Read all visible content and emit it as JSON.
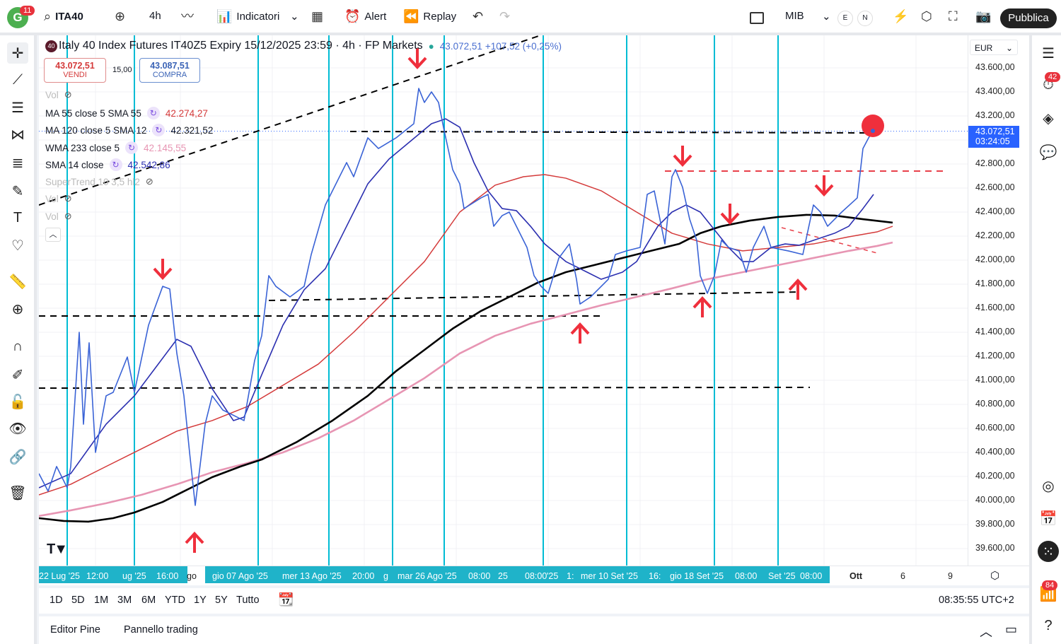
{
  "topbar": {
    "avatar_letter": "G",
    "avatar_badge": "11",
    "symbol": "ITA40",
    "interval": "4h",
    "indicators": "Indicatori",
    "alert": "Alert",
    "replay": "Replay",
    "layout_name": "MIB",
    "session_e": "E",
    "session_n": "N",
    "publish": "Pubblica"
  },
  "legend": {
    "badge": "40",
    "title": "Italy 40 Index Futures IT40Z5 Expiry 15/12/2025 23:59 · 4h · FP Markets",
    "last": "43.072,51",
    "change": "+107,52 (+0,25%)",
    "sell_price": "43.072,51",
    "sell_label": "VENDI",
    "spread": "15,00",
    "buy_price": "43.087,51",
    "buy_label": "COMPRA",
    "indicators": [
      {
        "name": "Vol",
        "value": ""
      },
      {
        "name": "MA 55 close 5 SMA 55",
        "value": "42.274,27"
      },
      {
        "name": "MA 120 close 5 SMA 12",
        "value": "42.321,52"
      },
      {
        "name": "WMA 233 close 5",
        "value": "42.145,55"
      },
      {
        "name": "SMA 14 close",
        "value": "42.542,86"
      },
      {
        "name": "SuperTrend 10 3,5 hl2",
        "value": ""
      },
      {
        "name": "Vol",
        "value": ""
      },
      {
        "name": "Vol",
        "value": ""
      }
    ]
  },
  "price_scale": {
    "currency": "EUR",
    "labels": [
      "43.600,00",
      "43.400,00",
      "43.200,00",
      "42.800,00",
      "42.600,00",
      "42.400,00",
      "42.200,00",
      "42.000,00",
      "41.800,00",
      "41.600,00",
      "41.400,00",
      "41.200,00",
      "41.000,00",
      "40.800,00",
      "40.600,00",
      "40.400,00",
      "40.200,00",
      "40.000,00",
      "39.800,00",
      "39.600,00"
    ],
    "current_price": "43.072,51",
    "countdown": "03:24:05"
  },
  "time_axis": {
    "labels": [
      "22 Lug '25",
      "12:00",
      "ug '25",
      "16:00",
      "go",
      "gio 07 Ago '25",
      "mer 13 Ago '25",
      "20:00",
      "g",
      "mar 26 Ago '25",
      "08:00",
      "25",
      "08:00",
      "'25",
      "1:",
      "mer 10 Set '25",
      "16:",
      "gio 18 Set '25",
      "08:00",
      "Set '25",
      "08:00",
      "Ott",
      "6",
      "9"
    ]
  },
  "ranges": [
    "1D",
    "5D",
    "1M",
    "3M",
    "6M",
    "YTD",
    "1Y",
    "5Y",
    "Tutto"
  ],
  "clock": "08:35:55 UTC+2",
  "bottom_tabs": [
    "Editor Pine",
    "Pannello trading"
  ],
  "sidebar": {
    "alerts_badge": "42",
    "notifications_badge": "84"
  },
  "colors": {
    "close": "#3a63d6",
    "sma14": "#2b2fb0",
    "ma55": "#d43a3a",
    "ma120": "#000000",
    "wma233": "#e795b3",
    "cyan": "#00bcd4",
    "arrow": "#ef2f3c"
  },
  "chart_data": {
    "type": "line",
    "ylim": [
      39500,
      43700
    ],
    "x_unit": "bar index (4h)",
    "series": [
      {
        "name": "close",
        "values": [
          [
            0,
            40224
          ],
          [
            1.3,
            40077
          ],
          [
            2.5,
            40283
          ],
          [
            4,
            40106
          ],
          [
            4.5,
            40283
          ],
          [
            5.7,
            41400
          ],
          [
            6.3,
            40635
          ],
          [
            7.1,
            41312
          ],
          [
            8,
            40400
          ],
          [
            9.5,
            40871
          ],
          [
            10.5,
            40900
          ],
          [
            12.5,
            41194
          ],
          [
            13.5,
            40900
          ],
          [
            15.5,
            41459
          ],
          [
            17.5,
            41782
          ],
          [
            18.5,
            41760
          ],
          [
            19.5,
            41224
          ],
          [
            20.5,
            40871
          ],
          [
            21.3,
            40400
          ],
          [
            22.1,
            39959
          ],
          [
            23.5,
            40635
          ],
          [
            24.5,
            40871
          ],
          [
            26,
            40753
          ],
          [
            29,
            40665
          ],
          [
            30.5,
            41165
          ],
          [
            31.5,
            41371
          ],
          [
            32.5,
            41871
          ],
          [
            33.5,
            41782
          ],
          [
            35.5,
            41694
          ],
          [
            37.5,
            41782
          ],
          [
            38.5,
            42047
          ],
          [
            40.5,
            42459
          ],
          [
            43.5,
            42812
          ],
          [
            44.5,
            42694
          ],
          [
            46.5,
            43018
          ],
          [
            48,
            42929
          ],
          [
            50.5,
            43018
          ],
          [
            53,
            43135
          ],
          [
            53.7,
            43429
          ],
          [
            54.5,
            43312
          ],
          [
            55.5,
            43400
          ],
          [
            56.5,
            43312
          ],
          [
            57.3,
            43076
          ],
          [
            58.5,
            42753
          ],
          [
            59.5,
            42635
          ],
          [
            60.1,
            42429
          ],
          [
            62.5,
            42518
          ],
          [
            63.5,
            42547
          ],
          [
            64.3,
            42282
          ],
          [
            65.5,
            42371
          ],
          [
            66.5,
            42400
          ],
          [
            69,
            42106
          ],
          [
            70,
            41871
          ],
          [
            71,
            41782
          ],
          [
            72,
            41724
          ],
          [
            73.5,
            42017
          ],
          [
            75,
            42135
          ],
          [
            76,
            41841
          ],
          [
            76.5,
            41635
          ],
          [
            78,
            41694
          ],
          [
            80.5,
            41841
          ],
          [
            81.5,
            42047
          ],
          [
            83,
            42076
          ],
          [
            85,
            42106
          ],
          [
            86,
            42547
          ],
          [
            87,
            42576
          ],
          [
            88.5,
            42135
          ],
          [
            89.5,
            42694
          ],
          [
            90,
            42753
          ],
          [
            91,
            42606
          ],
          [
            92,
            42341
          ],
          [
            93,
            42165
          ],
          [
            93.5,
            41871
          ],
          [
            94.5,
            41724
          ],
          [
            95.5,
            41871
          ],
          [
            96.5,
            42165
          ],
          [
            97.5,
            42106
          ],
          [
            99,
            42076
          ],
          [
            100,
            41900
          ],
          [
            101,
            42106
          ],
          [
            102.5,
            42282
          ],
          [
            103.5,
            42106
          ],
          [
            106,
            42076
          ],
          [
            108,
            42047
          ],
          [
            109.5,
            42459
          ],
          [
            110.5,
            42400
          ],
          [
            111.5,
            42282
          ],
          [
            112.5,
            42341
          ],
          [
            113.5,
            42400
          ],
          [
            115.7,
            42518
          ],
          [
            116.5,
            42929
          ],
          [
            117.3,
            43018
          ],
          [
            118,
            43076
          ]
        ]
      },
      {
        "name": "SMA 14",
        "values": [
          [
            0,
            40106
          ],
          [
            4.5,
            40224
          ],
          [
            9.5,
            40635
          ],
          [
            13.5,
            40871
          ],
          [
            16.5,
            41106
          ],
          [
            19.5,
            41341
          ],
          [
            21.5,
            41283
          ],
          [
            24.5,
            40930
          ],
          [
            27.5,
            40665
          ],
          [
            29,
            40694
          ],
          [
            31.5,
            41047
          ],
          [
            34.5,
            41459
          ],
          [
            37.5,
            41753
          ],
          [
            40.5,
            41929
          ],
          [
            43.5,
            42282
          ],
          [
            46.5,
            42635
          ],
          [
            49.5,
            42841
          ],
          [
            52.5,
            42988
          ],
          [
            55.5,
            43135
          ],
          [
            57.5,
            43176
          ],
          [
            59.5,
            43106
          ],
          [
            61.5,
            42812
          ],
          [
            63.5,
            42576
          ],
          [
            65.5,
            42429
          ],
          [
            67.5,
            42412
          ],
          [
            69.5,
            42282
          ],
          [
            71.5,
            42135
          ],
          [
            74.5,
            41988
          ],
          [
            77.5,
            41900
          ],
          [
            79.5,
            41841
          ],
          [
            82.5,
            41900
          ],
          [
            84.5,
            41988
          ],
          [
            87.5,
            42282
          ],
          [
            89.5,
            42400
          ],
          [
            91.5,
            42459
          ],
          [
            93.5,
            42400
          ],
          [
            95.5,
            42253
          ],
          [
            97.5,
            42106
          ],
          [
            99.5,
            41988
          ],
          [
            101,
            41988
          ],
          [
            103.5,
            42106
          ],
          [
            105.5,
            42135
          ],
          [
            107.5,
            42124
          ],
          [
            109.5,
            42165
          ],
          [
            112.5,
            42224
          ],
          [
            114.5,
            42282
          ],
          [
            116.5,
            42429
          ],
          [
            118,
            42547
          ]
        ]
      },
      {
        "name": "MA 55",
        "values": [
          [
            0,
            40047
          ],
          [
            4.5,
            40135
          ],
          [
            9.5,
            40283
          ],
          [
            14.5,
            40430
          ],
          [
            19.5,
            40577
          ],
          [
            24.5,
            40665
          ],
          [
            29.5,
            40783
          ],
          [
            34.5,
            40959
          ],
          [
            39.5,
            41135
          ],
          [
            44.5,
            41400
          ],
          [
            49.5,
            41694
          ],
          [
            54.5,
            41988
          ],
          [
            59.5,
            42400
          ],
          [
            64.5,
            42624
          ],
          [
            68.5,
            42694
          ],
          [
            71.5,
            42712
          ],
          [
            74.5,
            42682
          ],
          [
            79.5,
            42577
          ],
          [
            84.5,
            42400
          ],
          [
            89.5,
            42224
          ],
          [
            94.5,
            42135
          ],
          [
            99.5,
            42077
          ],
          [
            104.5,
            42106
          ],
          [
            109.5,
            42135
          ],
          [
            114.5,
            42194
          ],
          [
            118.5,
            42235
          ],
          [
            120.7,
            42282
          ]
        ]
      },
      {
        "name": "MA 120",
        "values": [
          [
            0,
            39853
          ],
          [
            3.5,
            39830
          ],
          [
            7,
            39824
          ],
          [
            10.5,
            39853
          ],
          [
            13.5,
            39900
          ],
          [
            17.5,
            39988
          ],
          [
            21.5,
            40106
          ],
          [
            24.5,
            40194
          ],
          [
            28.5,
            40283
          ],
          [
            31.5,
            40341
          ],
          [
            36.5,
            40488
          ],
          [
            41.5,
            40665
          ],
          [
            46.5,
            40871
          ],
          [
            50.5,
            41077
          ],
          [
            54.5,
            41253
          ],
          [
            58.5,
            41430
          ],
          [
            62.5,
            41577
          ],
          [
            66.5,
            41694
          ],
          [
            70.5,
            41812
          ],
          [
            74.5,
            41900
          ],
          [
            78.5,
            41959
          ],
          [
            82.5,
            42018
          ],
          [
            86.5,
            42077
          ],
          [
            90.5,
            42135
          ],
          [
            93.5,
            42224
          ],
          [
            96.5,
            42282
          ],
          [
            100.5,
            42329
          ],
          [
            104.5,
            42359
          ],
          [
            108.5,
            42377
          ],
          [
            112.5,
            42371
          ],
          [
            116.5,
            42341
          ],
          [
            120.7,
            42312
          ]
        ]
      },
      {
        "name": "WMA 233",
        "values": [
          [
            0,
            39871
          ],
          [
            4.5,
            39918
          ],
          [
            9.5,
            39977
          ],
          [
            14.5,
            40047
          ],
          [
            19.5,
            40135
          ],
          [
            24.5,
            40235
          ],
          [
            29.5,
            40312
          ],
          [
            34.5,
            40400
          ],
          [
            39.5,
            40518
          ],
          [
            44.5,
            40665
          ],
          [
            49.5,
            40841
          ],
          [
            54.5,
            41018
          ],
          [
            59.5,
            41224
          ],
          [
            64.5,
            41371
          ],
          [
            69.5,
            41471
          ],
          [
            74.5,
            41547
          ],
          [
            79.5,
            41624
          ],
          [
            84.5,
            41694
          ],
          [
            89.5,
            41765
          ],
          [
            94.5,
            41841
          ],
          [
            99.5,
            41900
          ],
          [
            104.5,
            41959
          ],
          [
            109.5,
            42018
          ],
          [
            114.5,
            42077
          ],
          [
            118.5,
            42118
          ],
          [
            120.7,
            42147
          ]
        ]
      }
    ]
  }
}
